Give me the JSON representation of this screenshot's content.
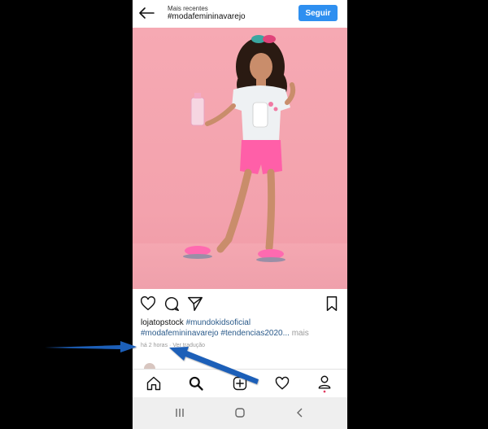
{
  "header": {
    "subtitle": "Mais recentes",
    "title": "#modafemininavarejo",
    "follow_label": "Seguir"
  },
  "post": {
    "username": "lojatopstock",
    "caption_tags_line1": "#mundokidsoficial",
    "caption_tags_line2": "#modafemininavarejo #tendencias2020...",
    "more_label": "mais",
    "time": "há 2 horas",
    "separator": "·",
    "translation_label": "Ver tradução"
  },
  "icons": {
    "back": "arrow-left-icon",
    "like": "heart-icon",
    "comment": "comment-icon",
    "share": "send-icon",
    "save": "bookmark-icon",
    "home": "home-icon",
    "search": "search-icon",
    "add": "plus-square-icon",
    "activity": "heart-icon",
    "profile": "user-icon"
  },
  "colors": {
    "accent": "#2e8ff0",
    "photo_background": "#f6a9b3",
    "annotation_arrow": "#1f5fb8",
    "notification_dot": "#e03a5f"
  }
}
